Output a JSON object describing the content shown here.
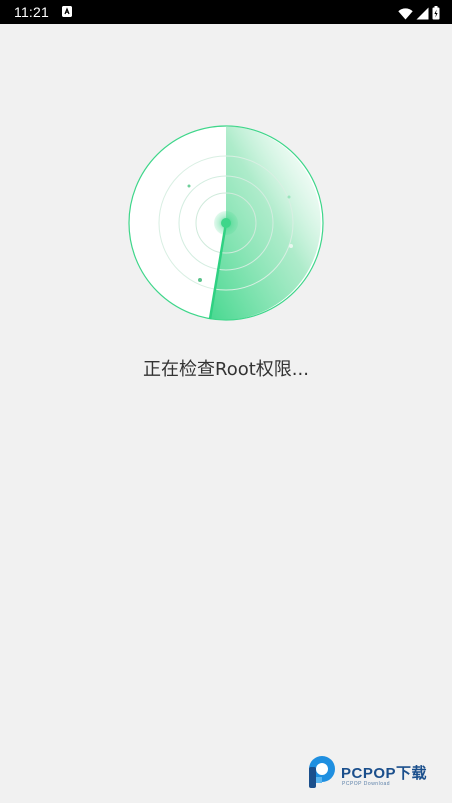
{
  "status_bar": {
    "time": "11:21"
  },
  "main": {
    "status_text": "正在检查Root权限..."
  },
  "watermark": {
    "brand": "PCPOP",
    "brand_cn": "下载",
    "sub": "PCPOP Download"
  },
  "colors": {
    "accent": "#3ed68a",
    "background": "#f1f1f1"
  }
}
